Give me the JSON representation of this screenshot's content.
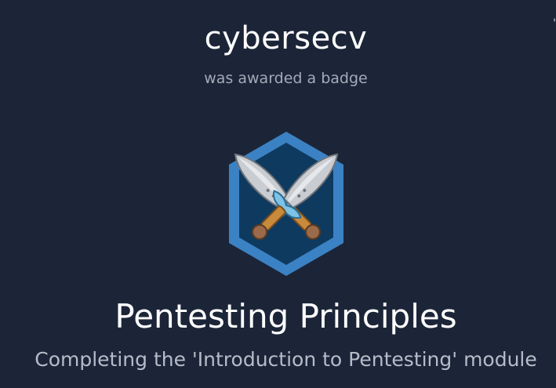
{
  "award": {
    "username": "cybersecv",
    "awarded_text": "was awarded a badge",
    "edge_char": "'"
  },
  "badge": {
    "icon": "crossed-daggers-icon",
    "title": "Pentesting Principles",
    "description": "Completing the 'Introduction to Pentesting' module"
  },
  "colors": {
    "background": "#1c2538",
    "hex_border": "#3b82c4",
    "hex_inner": "#0f3a5f",
    "blade": "#c9cdd2",
    "guard": "#7ec3e6",
    "handle": "#c98a3c"
  }
}
